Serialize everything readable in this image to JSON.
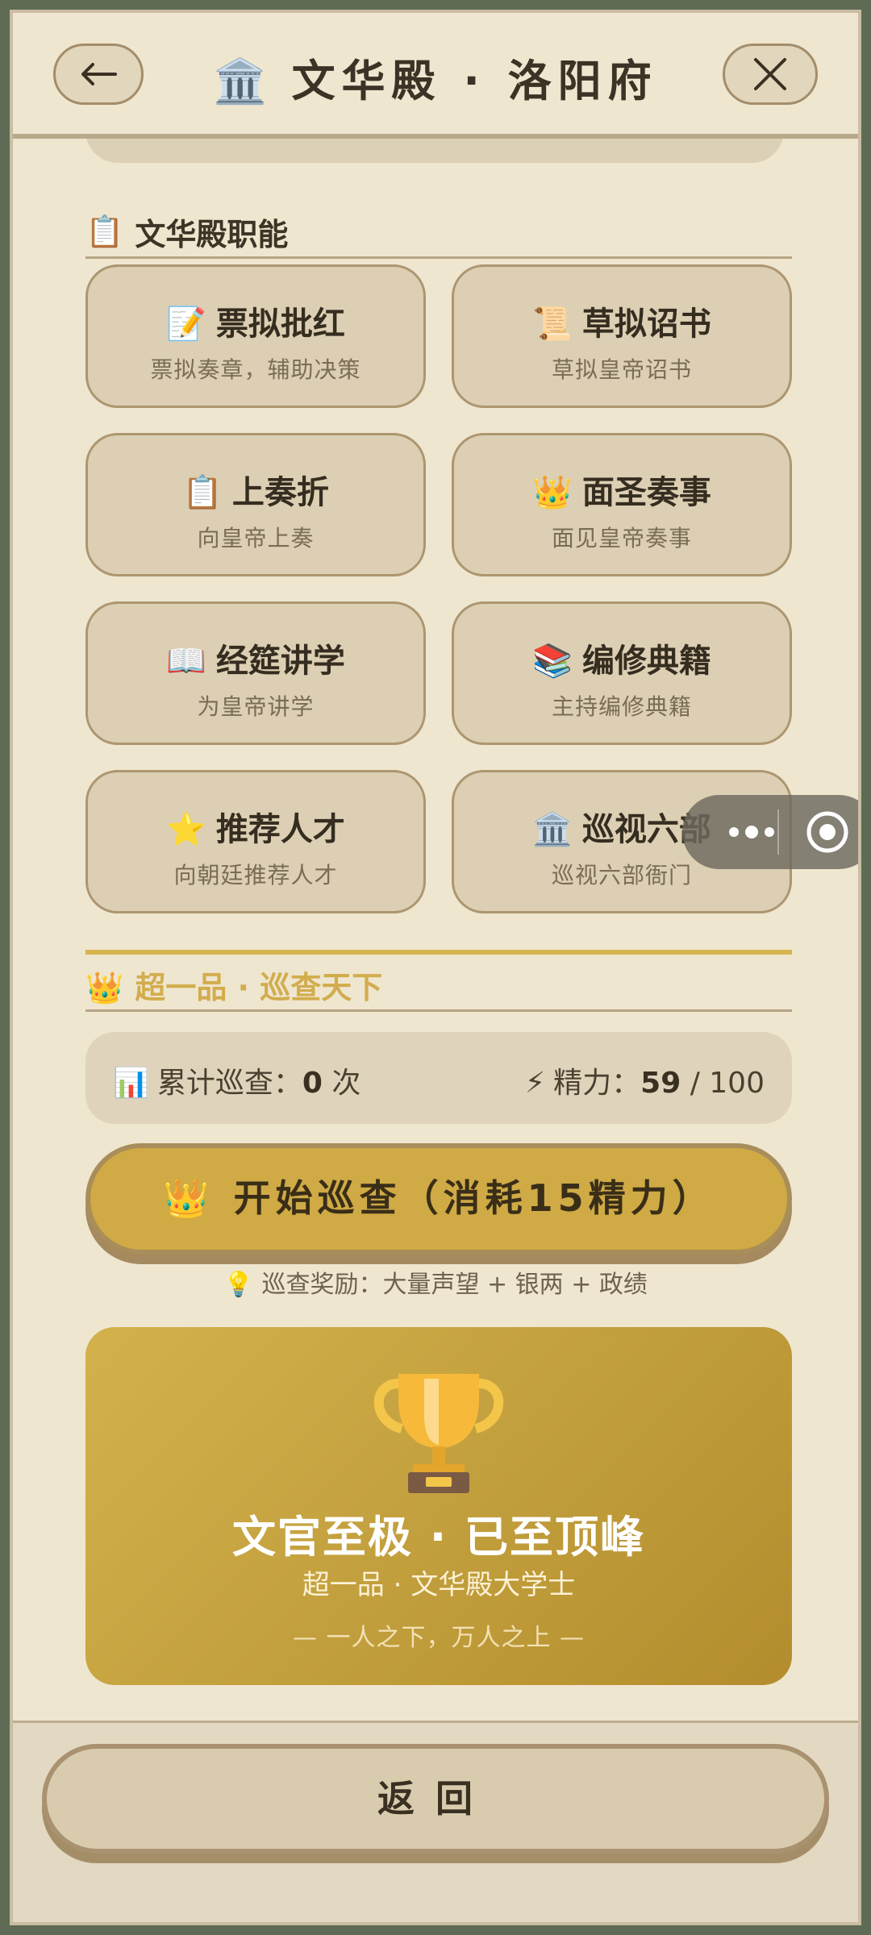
{
  "header": {
    "icon": "🏛️",
    "title": "文华殿 · 洛阳府"
  },
  "section": {
    "icon": "📋",
    "title": "文华殿职能"
  },
  "functions": [
    {
      "icon": "📝",
      "name": "票拟批红",
      "desc": "票拟奏章，辅助决策"
    },
    {
      "icon": "📜",
      "name": "草拟诏书",
      "desc": "草拟皇帝诏书"
    },
    {
      "icon": "📋",
      "name": "上奏折",
      "desc": "向皇帝上奏"
    },
    {
      "icon": "👑",
      "name": "面圣奏事",
      "desc": "面见皇帝奏事"
    },
    {
      "icon": "📖",
      "name": "经筵讲学",
      "desc": "为皇帝讲学"
    },
    {
      "icon": "📚",
      "name": "编修典籍",
      "desc": "主持编修典籍"
    },
    {
      "icon": "⭐",
      "name": "推荐人才",
      "desc": "向朝廷推荐人才"
    },
    {
      "icon": "🏛️",
      "name": "巡视六部",
      "desc": "巡视六部衙门"
    }
  ],
  "inspection": {
    "icon": "👑",
    "title": "超一品 · 巡查天下",
    "count_icon": "📊",
    "count_label": "累计巡查：",
    "count_value": "0",
    "count_unit": "次",
    "energy_icon": "⚡",
    "energy_label": "精力：",
    "energy_value": "59",
    "energy_max": "/ 100",
    "start_icon": "👑",
    "start_label": "开始巡查（消耗15精力）",
    "reward_icon": "💡",
    "reward_text": "巡查奖励：大量声望 + 银两 + 政绩"
  },
  "peak": {
    "icon_name": "trophy-icon",
    "title": "文官至极 · 已至顶峰",
    "subtitle": "超一品 · 文华殿大学士",
    "motto": "— 一人之下，万人之上 —"
  },
  "footer": {
    "return_label": "返回"
  },
  "colors": {
    "background": "#efe6d0",
    "card": "#dccfb3",
    "gold": "#cfaa45",
    "border": "#ad9670"
  }
}
